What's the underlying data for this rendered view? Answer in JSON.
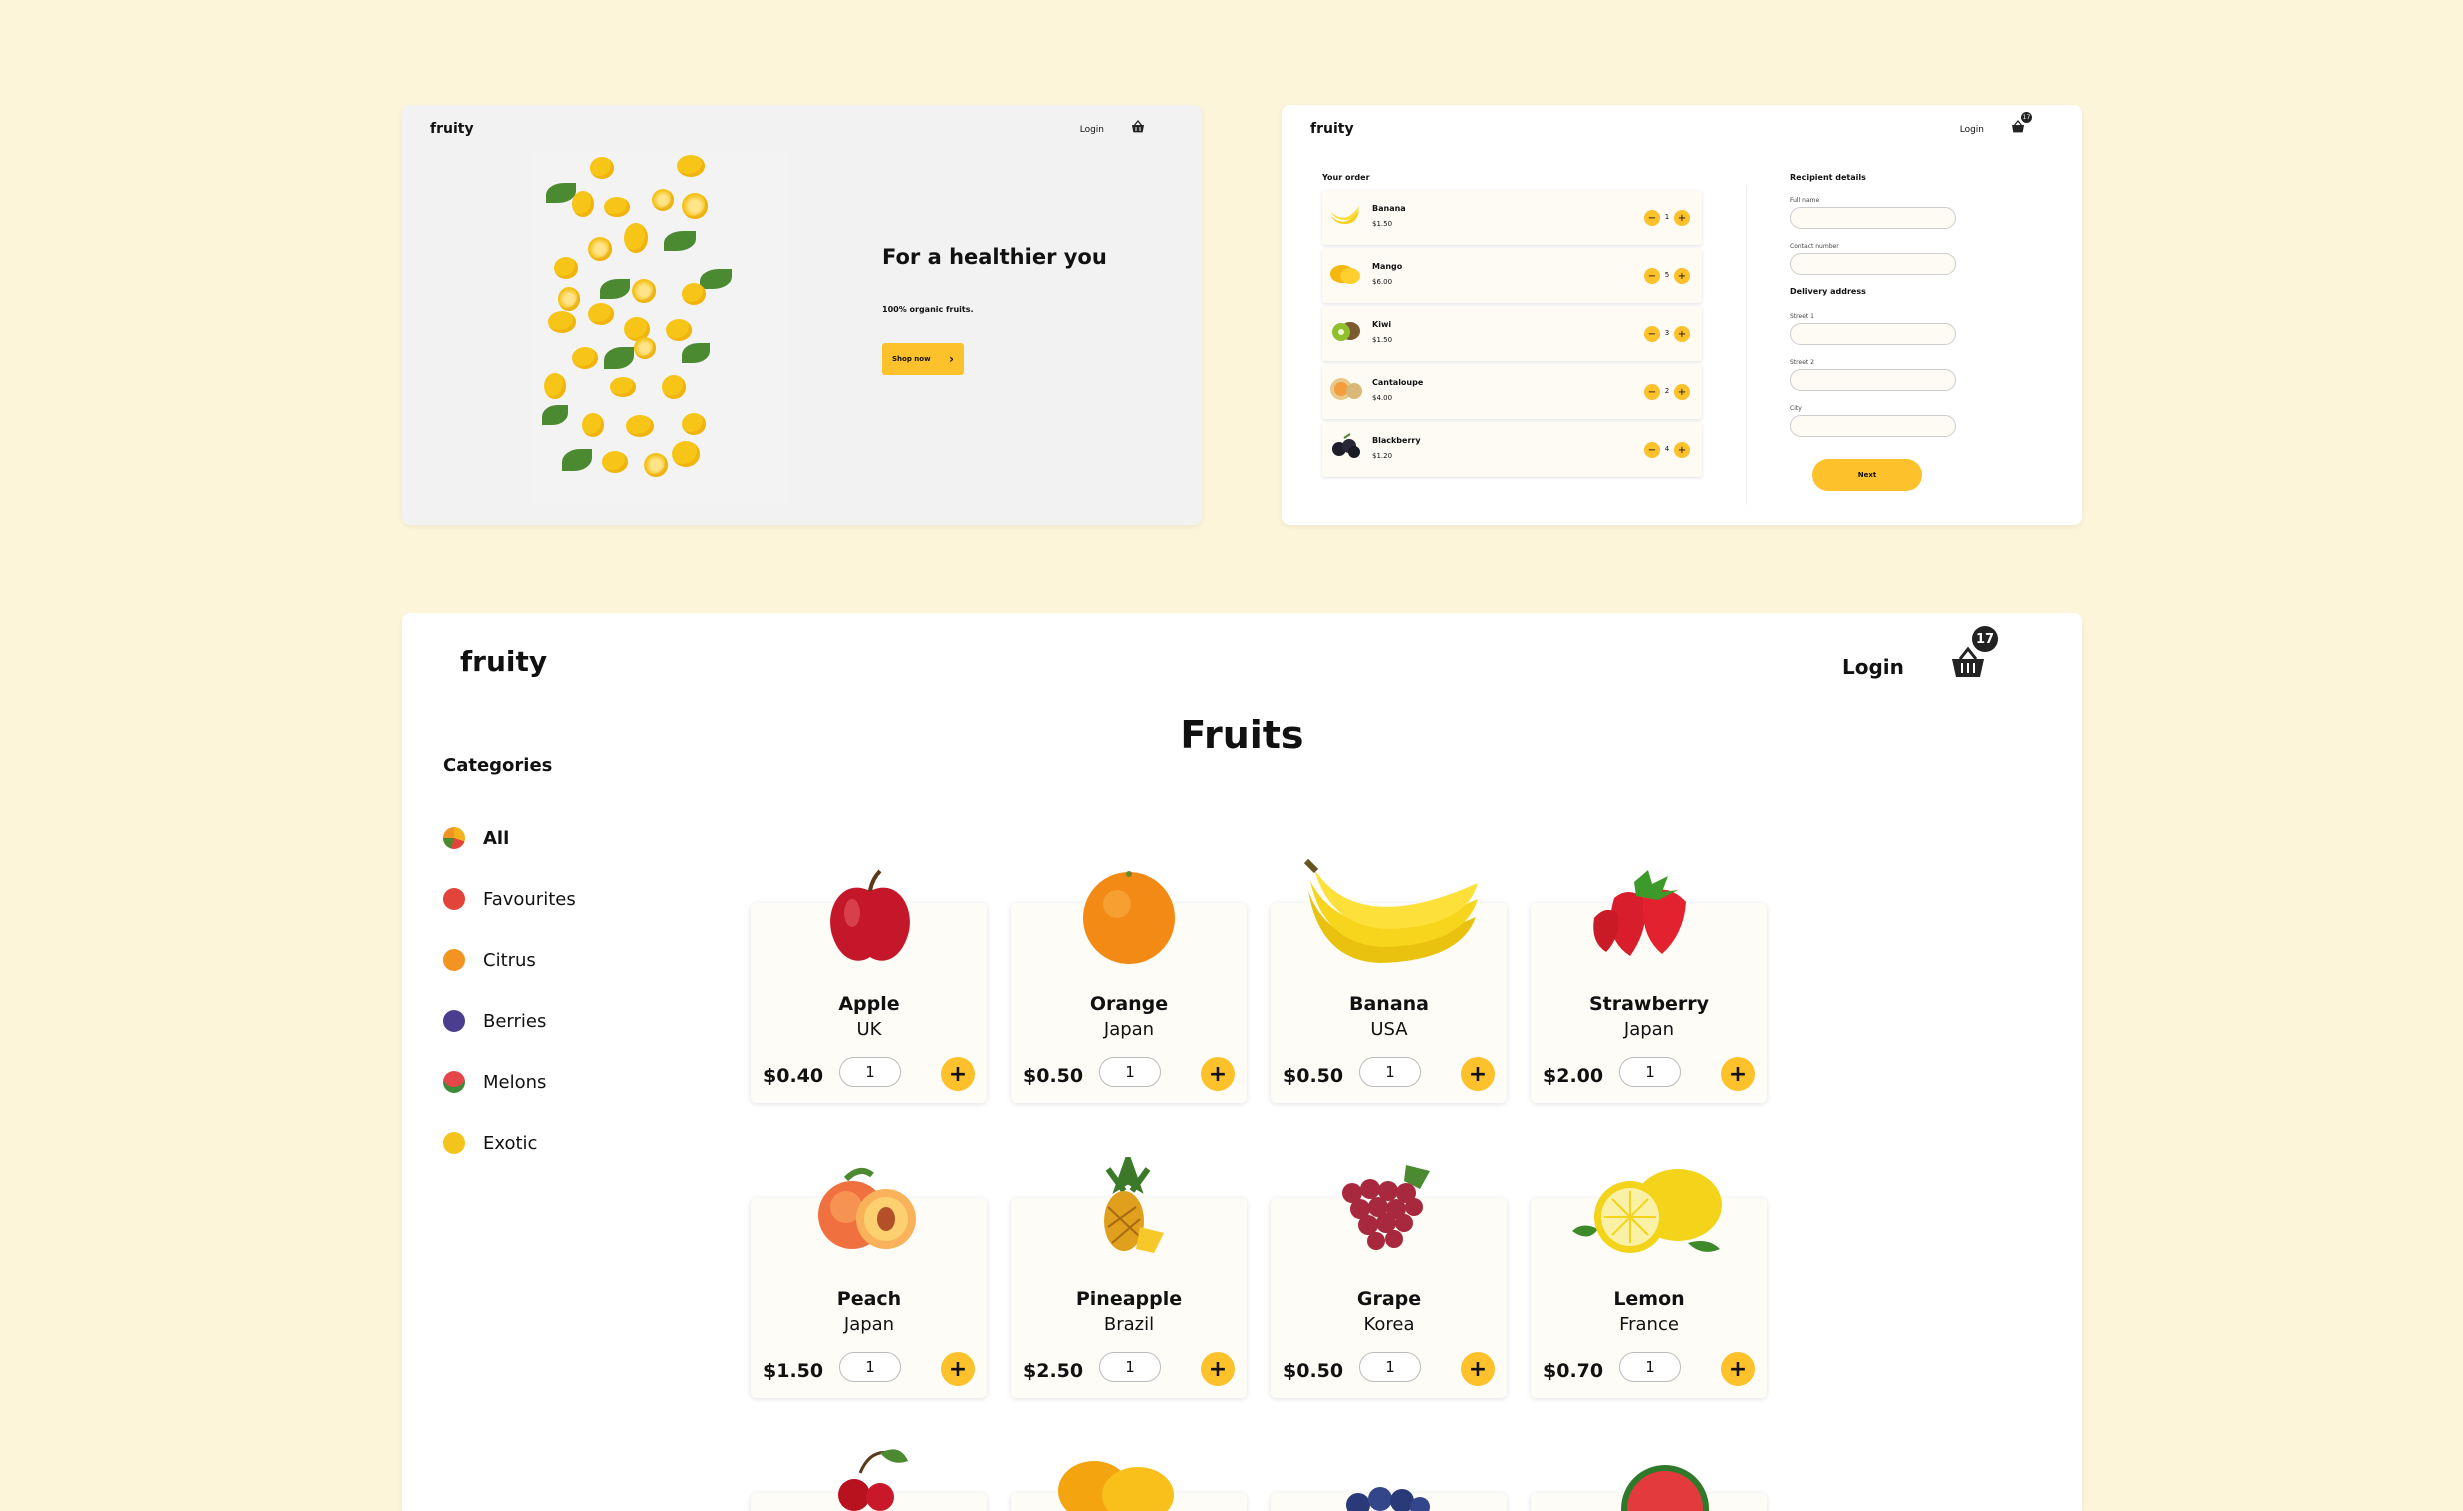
{
  "brand": "fruity",
  "hero": {
    "login": "Login",
    "title": "For a healthier you",
    "subtitle": "100% organic fruits.",
    "cta": "Shop now",
    "cta_arrow": "›"
  },
  "checkout": {
    "login": "Login",
    "cart_count": "17",
    "order_title": "Your order",
    "items": [
      {
        "name": "Banana",
        "price": "$1.50",
        "qty": "1"
      },
      {
        "name": "Mango",
        "price": "$6.00",
        "qty": "5"
      },
      {
        "name": "Kiwi",
        "price": "$1.50",
        "qty": "3"
      },
      {
        "name": "Cantaloupe",
        "price": "$4.00",
        "qty": "2"
      },
      {
        "name": "Blackberry",
        "price": "$1.20",
        "qty": "4"
      }
    ],
    "minus": "−",
    "plus": "+",
    "recipient_title": "Recipient details",
    "full_name": "Full name",
    "contact_number": "Contact number",
    "delivery_title": "Delivery address",
    "street1": "Street 1",
    "street2": "Street 2",
    "city": "City",
    "next": "Next"
  },
  "shop": {
    "login": "Login",
    "cart_count": "17",
    "page_title": "Fruits",
    "categories_title": "Categories",
    "categories": [
      {
        "label": "All",
        "color": "#f2b21c"
      },
      {
        "label": "Favourites",
        "color": "#e2443a"
      },
      {
        "label": "Citrus",
        "color": "#f39322"
      },
      {
        "label": "Berries",
        "color": "#4b3e8f"
      },
      {
        "label": "Melons",
        "color": "#e5464a"
      },
      {
        "label": "Exotic",
        "color": "#f4c31c"
      }
    ],
    "add": "+",
    "products": [
      {
        "name": "Apple",
        "origin": "UK",
        "price": "$0.40",
        "qty": "1"
      },
      {
        "name": "Orange",
        "origin": "Japan",
        "price": "$0.50",
        "qty": "1"
      },
      {
        "name": "Banana",
        "origin": "USA",
        "price": "$0.50",
        "qty": "1"
      },
      {
        "name": "Strawberry",
        "origin": "Japan",
        "price": "$2.00",
        "qty": "1"
      },
      {
        "name": "Peach",
        "origin": "Japan",
        "price": "$1.50",
        "qty": "1"
      },
      {
        "name": "Pineapple",
        "origin": "Brazil",
        "price": "$2.50",
        "qty": "1"
      },
      {
        "name": "Grape",
        "origin": "Korea",
        "price": "$0.50",
        "qty": "1"
      },
      {
        "name": "Lemon",
        "origin": "France",
        "price": "$0.70",
        "qty": "1"
      }
    ]
  }
}
